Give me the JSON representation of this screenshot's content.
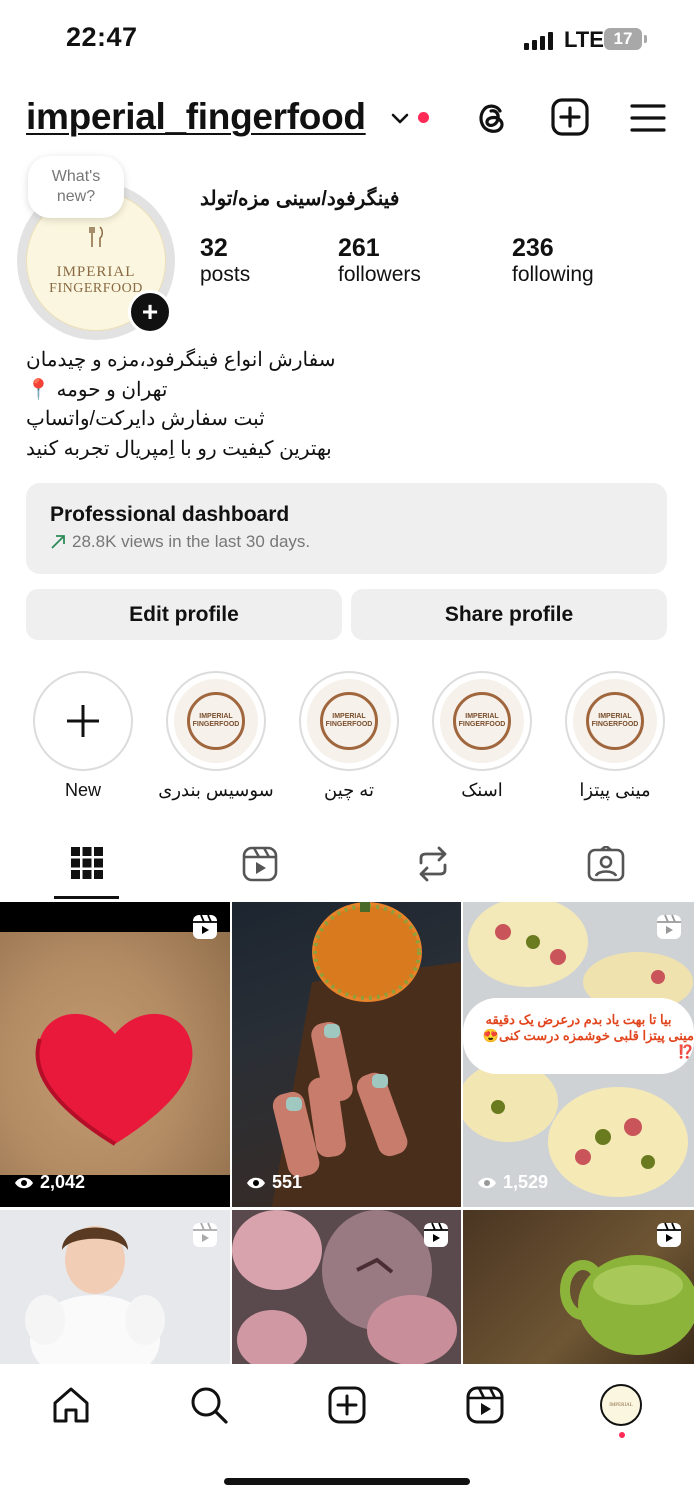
{
  "status_bar": {
    "time": "22:47",
    "network": "LTE",
    "battery": "17"
  },
  "header": {
    "username": "imperial_fingerfood"
  },
  "profile": {
    "whats_new_line1": "What's",
    "whats_new_line2": "new?",
    "logo_line1": "IMPERIAL",
    "logo_line2": "FINGERFOOD",
    "full_name": "فینگرفود/سینی مزه/تولد",
    "stats": [
      {
        "value": "32",
        "label": "posts"
      },
      {
        "value": "261",
        "label": "followers"
      },
      {
        "value": "236",
        "label": "following"
      }
    ],
    "bio": [
      "سفارش انواع فینگرفود،مزه و چیدمان",
      "تهران و حومه 📍",
      "ثبت سفارش دایرکت/واتساپ",
      "بهترین کیفیت رو با اِمپریال تجربه کنید"
    ]
  },
  "dashboard": {
    "title": "Professional dashboard",
    "subtitle": "28.8K views in the last 30 days."
  },
  "buttons": {
    "edit": "Edit profile",
    "share": "Share profile"
  },
  "highlights": [
    {
      "label": "New"
    },
    {
      "label": "سوسیس بندری",
      "logo_a": "IMPERIAL",
      "logo_b": "FINGERFOOD"
    },
    {
      "label": "ته چین",
      "logo_a": "IMPERIAL",
      "logo_b": "FINGERFOOD"
    },
    {
      "label": "اسنک",
      "logo_a": "IMPERIAL",
      "logo_b": "FINGERFOOD"
    },
    {
      "label": "مینی پیتزا",
      "logo_a": "IMPERIAL",
      "logo_b": "FINGERFOOD"
    }
  ],
  "tabs": [
    "grid-icon",
    "reels-icon",
    "reposts-icon",
    "tagged-icon"
  ],
  "posts": [
    {
      "views": "2,042"
    },
    {
      "views": "551"
    },
    {
      "views": "1,529",
      "overlay_line1": "بیا تا بهت یاد بدم درعرض یک دقیقه",
      "overlay_line2": "مینی پیتزا قلبی خوشمزه درست کنی😍 ⁉️"
    },
    {
      "views": ""
    },
    {
      "views": ""
    },
    {
      "views": ""
    }
  ],
  "colors": {
    "accent_red": "#ff2a55",
    "button_bg": "#efefef",
    "growth_green": "#2e8b57"
  }
}
